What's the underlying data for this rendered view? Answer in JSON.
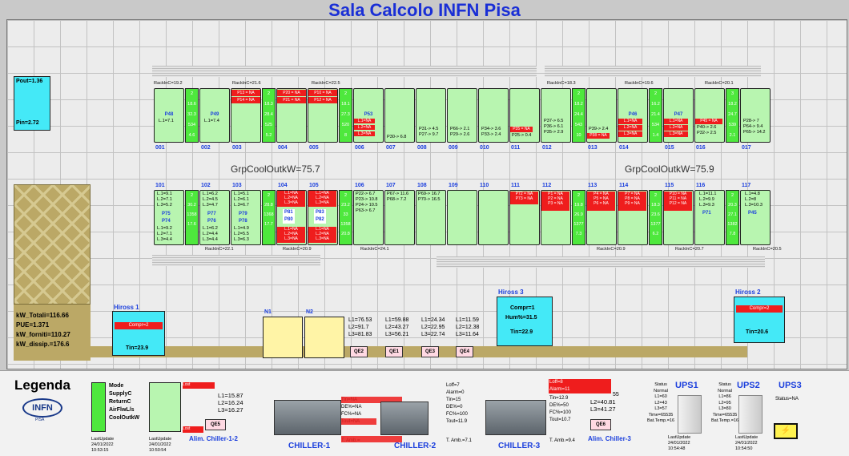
{
  "title": "Sala Calcolo INFN Pisa",
  "pout": "Pout=1.36",
  "pin": "Pin=2.72",
  "grp1": "GrpCoolOutkW=75.7",
  "grp2": "GrpCoolOutkW=75.9",
  "kw": {
    "totali": "kW_Totali=116.66",
    "pue": "PUE=1.371",
    "forniti": "kW_forniti=110.27",
    "dissip": "kW_dissip.=176.6"
  },
  "top_racks": {
    "rackin": [
      "RackInC=19.2",
      "RackInC=21.6",
      "RackInC=22.5",
      "RackInC=18.3",
      "RackInC=19.6",
      "RackInC=20.1"
    ],
    "nums": [
      "001",
      "002",
      "003",
      "004",
      "005",
      "006",
      "007",
      "008",
      "009",
      "010",
      "011",
      "012",
      "013",
      "014",
      "015",
      "016",
      "017"
    ],
    "col1": [
      "2",
      "18.6",
      "32.3",
      "534",
      "4.6"
    ],
    "col2": [
      "2",
      "18.3",
      "28.4",
      "525",
      "5.2"
    ],
    "col3": [
      "2",
      "18.1",
      "27.3",
      "520",
      "8"
    ],
    "col4": [
      "2",
      "18.2",
      "24.4",
      "543",
      "10"
    ],
    "col5": [
      "2",
      "16.2",
      "21.4",
      "534",
      "1.4"
    ],
    "col6": [
      "3",
      "18.2",
      "24.7",
      "539",
      "2.1"
    ],
    "p48": "P48",
    "p48l": "L.1=7.1",
    "p49": "P49",
    "p49l": "L.1=7.4",
    "r003a": "P13 = NA",
    "r003b": "P14 = NA",
    "r004a": "P20 = NA",
    "r004b": "P21 = NA",
    "r005a": "P10 = NA",
    "r005b": "P12 = NA",
    "p53": "P53",
    "p53a": "L.1=NA",
    "p53b": "L.2=NA",
    "p53c": "L.3=NA",
    "p30": "P30-> 6.8",
    "r008": "P31-> 4.5\nP27-> 9.7",
    "r009": "P66-> 2.1\nP29-> 2.6",
    "r010": "P34-> 3.6\nP33-> 2.4",
    "r011a": "P35 = NA",
    "r011b": "P25-> 0.4",
    "r012": "P37-> 6.5\nP36-> 6.1\nP35-> 2.9",
    "r013a": "P39-> 2.4",
    "r013b": "P38 = NA",
    "p46": "P46",
    "p46a": "L.1=NA",
    "p46b": "L.2=NA",
    "p46c": "L.3=NA",
    "p47": "P47",
    "p47a": "L.1=NA",
    "p47b": "L.2=NA",
    "p47c": "L.3=NA",
    "r016a": "P45 = NA",
    "r016b": "P40-> 2.6\nP32-> 2.5",
    "r017": "P28-> 7\nP64-> 9.4\nP65-> 14.2"
  },
  "bot_racks": {
    "nums": [
      "101",
      "102",
      "103",
      "104",
      "105",
      "106",
      "107",
      "108",
      "109",
      "110",
      "111",
      "112",
      "113",
      "114",
      "115",
      "116",
      "117"
    ],
    "rackin": [
      "RackInC=22.1",
      "RackInC=20.9",
      "RackInC=24.1",
      "RackInC=20.9",
      "RackInC=20.7",
      "RackInC=20.5"
    ],
    "col1": [
      "2",
      "30.2",
      "1358",
      "17.6"
    ],
    "col2": [
      "2",
      "28.8",
      "1368",
      "17.7"
    ],
    "col3": [
      "2",
      "23.2",
      "33",
      "1358",
      "20.8"
    ],
    "col4": [
      "2",
      "19.8",
      "26.9",
      "1377",
      "7.3"
    ],
    "col5": [
      "2",
      "18.3",
      "23.6",
      "1377",
      "6.2"
    ],
    "col6": [
      "2",
      "20.3",
      "27.1",
      "1382",
      "7.8"
    ],
    "r101": "L.1=9.1\nL.2=7.1\nL.3=5.2",
    "r101p": "P75\nP74",
    "r101b": "L.1=9.2\nL.2=7.1\nL.3=4.4",
    "r102": "L.1=6.2\nL.2=4.5\nL.3=4.7",
    "r102p": "P77\nP76",
    "r102b": "L.1=6.2\nL.2=4.4\nL.3=4.4",
    "r103": "L.1=5.1\nL.2=6.1\nL.3=6.7",
    "r103p": "P79\nP78",
    "r103b": "L.1=4.9\nL.2=5.5\nL.3=6.3",
    "r104a": "L.1=NA\nL.2=NA\nL.3=NA",
    "r104p": "P81\nP80",
    "r104b": "L.1=NA\nL.2=NA\nL.3=NA",
    "r105a": "L.1=NA\nL.2=NA\nL.3=NA",
    "r105p": "P83\nP82",
    "r105b": "L.1=NA\nL.2=NA\nL.3=NA",
    "r106": "P22-> 6.7\nP23-> 10.8\nP24-> 10.5\nP63-> 6.7",
    "r107": "P67-> 11.6\nP68-> 7.2",
    "r108": "P69-> 16.7\nP70-> 16.5",
    "r111": "P72 = NA\nP73 = NA",
    "r112": "P1 = NA\nP2 = NA\nP3 = NA",
    "r113": "P4 = NA\nP5 = NA\nP6 = NA",
    "r114": "P7 = NA\nP8 = NA\nP9 = NA",
    "r115": "P10 = NA\nP11 = NA\nP12 = NA",
    "r116": "L.1=11.1\nL.2=9.9\nL.3=9.3",
    "r116p": "P71",
    "r117": "L.1=4.8\nL.2=8\nL.3=10.3",
    "r117p": "P45"
  },
  "hiross1": {
    "label": "Hiross 1",
    "compr": "Compr=2",
    "tin": "Tin=23.9"
  },
  "hiross2": {
    "label": "Hiross 2",
    "compr": "Compr=2",
    "tin": "Tin=20.6"
  },
  "hiross3": {
    "label": "Hiross 3",
    "compr": "Compr=1",
    "hum": "Hum%=31.5",
    "tin": "Tin=22.9"
  },
  "n1": "N1",
  "n2": "N2",
  "qe_vals": {
    "qe2": "L1=76.53\nL2=91.7\nL3=81.83",
    "qe1": "L1=59.88\nL2=43.27\nL3=56.21",
    "qe3": "L1=24.34\nL2=22.95\nL3=22.74",
    "qe4": "L1=11.59\nL2=12.38\nL3=11.64"
  },
  "qe": [
    "QE2",
    "QE1",
    "QE3",
    "QE4"
  ],
  "legend": {
    "title": "Legenda",
    "logo": "INFN",
    "logo_sub": "PISA",
    "modes": "Mode\nSupplyC\nReturnC\nAirFlwL/s\nCoolOutkW",
    "lu1": "LastUpdate\n24/01/2022\n10:53:15",
    "lu2": "LastUpdate\n24/01/2022\n10:50:54",
    "lost1": "Lost",
    "lost2": "Lost",
    "l5": "L1=15.87\nL2=16.24\nL3=16.27",
    "qe5": "QE5",
    "alim12": "Alim. Chiller-1-2",
    "ch1": "CHILLER-1",
    "ch2": "CHILLER-2",
    "ch3": "CHILLER-3",
    "ch1vals": "Tin=NA\nDE%=NA\nFC%=NA\nTout=NA",
    "ch1ta": "T. Amb.=",
    "ch2vals": "Loff=7\nAlarm=0\nTin=15\nDE%=0\nFC%=100\nTout=11.9",
    "ch2ta": "T. Amb.=7.1",
    "ch3top": "Loff=8\nAlarm=11",
    "ch3vals": "Tin=12.9\nDE%=50\nFC%=100\nTout=10.7",
    "ch3ta": "T. Amb.=9.4",
    "l6": "L2=40.81\nL3=41.27",
    "l6p": "55",
    "qe6": "QE6",
    "alim3": "Alim. Chiller-3",
    "ups1": "UPS1",
    "ups2": "UPS2",
    "ups3": "UPS3",
    "ups1vals": "Status\nNormal\nL1=60\nL2=43\nL3=57\nTime=65535\nBat.Temp.=16",
    "ups2vals": "Status\nNormal\nL1=86\nL2=95\nL3=80\nTime=65535\nBat.Temp.=16",
    "ups3vals": "Status=NA",
    "lu3": "LastUpdate\n24/01/2022\n10:54:48",
    "lu4": "LastUpdate\n24/01/2022\n10:54:50"
  }
}
